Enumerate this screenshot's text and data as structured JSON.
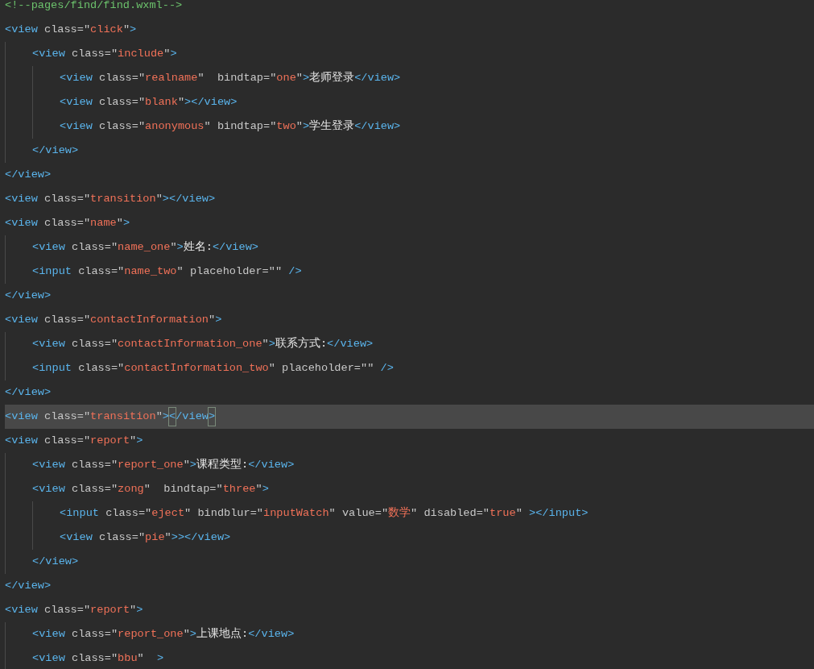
{
  "lines": [
    {
      "text": "<!--pages/find/find.wxml-->",
      "current": false
    },
    {
      "text": "<view class=\"click\">",
      "current": false,
      "children": [
        {
          "text": "<view class=\"include\">",
          "current": false,
          "children": [
            {
              "text": "<view class=\"realname\"  bindtap=\"one\">老师登录</view>",
              "current": false
            },
            {
              "text": "<view class=\"blank\"></view>",
              "current": false
            },
            {
              "text": "<view class=\"anonymous\" bindtap=\"two\">学生登录</view>",
              "current": false
            }
          ]
        },
        {
          "text": "</view>",
          "current": false
        }
      ]
    },
    {
      "text": "</view>",
      "current": false
    },
    {
      "text": "<view class=\"transition\"></view>",
      "current": false
    },
    {
      "text": "<view class=\"name\">",
      "current": false,
      "children": [
        {
          "text": "<view class=\"name_one\">姓名:</view>",
          "current": false
        },
        {
          "text": "<input class=\"name_two\" placeholder=\"\" />",
          "current": false
        }
      ]
    },
    {
      "text": "</view>",
      "current": false
    },
    {
      "text": "<view class=\"contactInformation\">",
      "current": false,
      "children": [
        {
          "text": "<view class=\"contactInformation_one\">联系方式:</view>",
          "current": false
        },
        {
          "text": "<input class=\"contactInformation_two\" placeholder=\"\" />",
          "current": false
        }
      ]
    },
    {
      "text": "</view>",
      "current": false
    },
    {
      "text": "<view class=\"transition\"></view>",
      "current": true
    },
    {
      "text": "<view class=\"report\">",
      "current": false,
      "children": [
        {
          "text": "<view class=\"report_one\">课程类型:</view>",
          "current": false
        },
        {
          "text": "<view class=\"zong\"  bindtap=\"three\">",
          "current": false,
          "children": [
            {
              "text": "<input class=\"eject\" bindblur=\"inputWatch\" value=\"数学\" disabled=\"true\" ></input>",
              "current": false
            },
            {
              "text": "<view class=\"pie\">></view>",
              "current": false
            }
          ]
        },
        {
          "text": "</view>",
          "current": false
        }
      ]
    },
    {
      "text": "</view>",
      "current": false
    },
    {
      "text": "<view class=\"report\">",
      "current": false,
      "children": [
        {
          "text": "<view class=\"report_one\">上课地点:</view>",
          "current": false
        },
        {
          "text": "<view class=\"bbu\"  >",
          "current": false
        }
      ]
    }
  ]
}
